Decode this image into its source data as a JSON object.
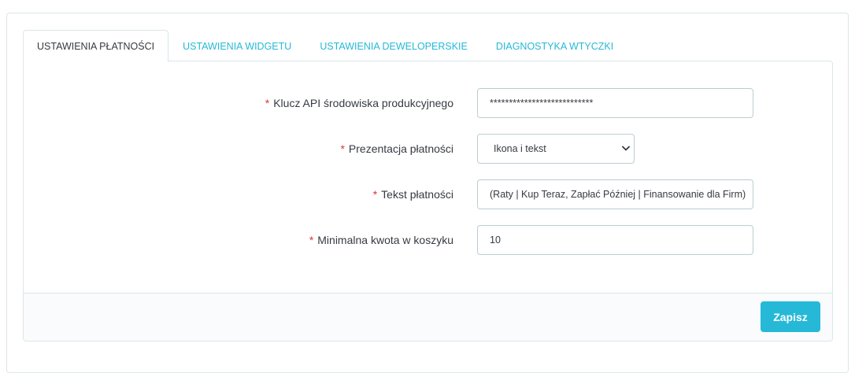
{
  "tabs": [
    {
      "label": "USTAWIENIA PŁATNOŚCI",
      "active": true
    },
    {
      "label": "USTAWIENIA WIDGETU",
      "active": false
    },
    {
      "label": "USTAWIENIA DEWELOPERSKIE",
      "active": false
    },
    {
      "label": "DIAGNOSTYKA WTYCZKI",
      "active": false
    }
  ],
  "form": {
    "required_mark": "*",
    "api_key": {
      "label": "Klucz API środowiska produkcyjnego",
      "value": "***************************"
    },
    "payment_presentation": {
      "label": "Prezentacja płatności",
      "value": "Ikona i tekst"
    },
    "payment_text": {
      "label": "Tekst płatności",
      "value": "(Raty | Kup Teraz, Zapłać Później | Finansowanie dla Firm)"
    },
    "min_cart_amount": {
      "label": "Minimalna kwota w koszyku",
      "value": "10"
    }
  },
  "footer": {
    "save_label": "Zapisz"
  },
  "colors": {
    "accent": "#25b9d7",
    "required": "#e0342d",
    "border": "#dbe6e9"
  },
  "icons": {
    "select_arrow": "chevron-down-icon"
  }
}
